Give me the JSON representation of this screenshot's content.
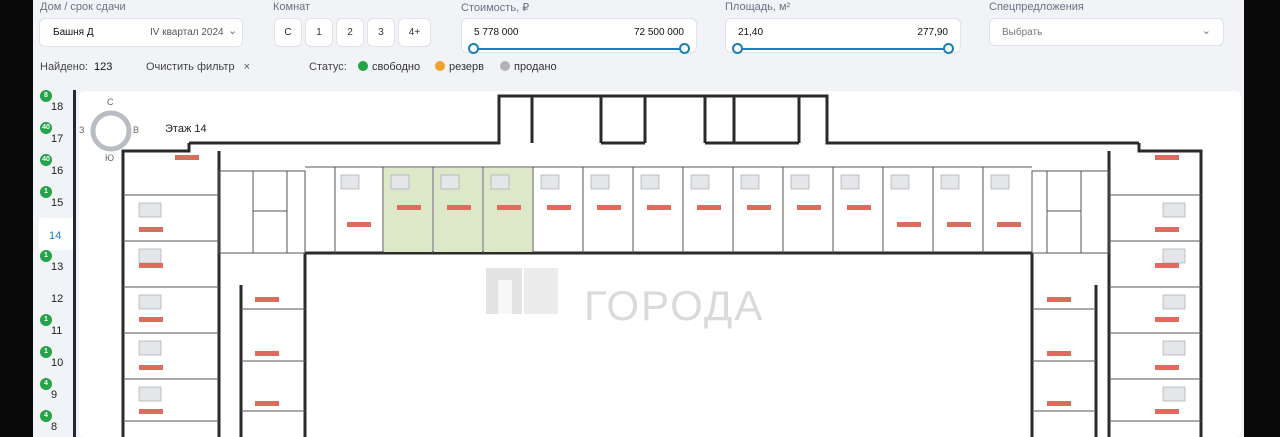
{
  "filters": {
    "house_label": "Дом / срок сдачи",
    "house_value": "Башня Д",
    "house_period": "IV квартал 2024",
    "rooms_label": "Комнат",
    "rooms": [
      "С",
      "1",
      "2",
      "3",
      "4+"
    ],
    "price_label": "Стоимость, ₽",
    "price_min": "5 778 000",
    "price_max": "72 500 000",
    "area_label": "Площадь, м²",
    "area_min": "21,40",
    "area_max": "277,90",
    "special_label": "Спецпредложения",
    "special_placeholder": "Выбрать"
  },
  "summary": {
    "found_label": "Найдено:",
    "found_count": "123",
    "clear_label": "Очистить фильтр",
    "clear_icon": "×",
    "status_label": "Статус:"
  },
  "statuses": [
    {
      "label": "свободно",
      "color": "#22a447"
    },
    {
      "label": "резерв",
      "color": "#f0a22e"
    },
    {
      "label": "продано",
      "color": "#b3b3b3"
    }
  ],
  "floors": [
    {
      "number": "18",
      "badge": "8"
    },
    {
      "number": "17",
      "badge": "40"
    },
    {
      "number": "16",
      "badge": "40"
    },
    {
      "number": "15",
      "badge": "1"
    },
    {
      "number": "14",
      "badge": "",
      "active": true
    },
    {
      "number": "13",
      "badge": "1"
    },
    {
      "number": "12",
      "badge": ""
    },
    {
      "number": "11",
      "badge": "1"
    },
    {
      "number": "10",
      "badge": "1"
    },
    {
      "number": "9",
      "badge": "4"
    },
    {
      "number": "8",
      "badge": "4"
    }
  ],
  "plan": {
    "floor_title": "Этаж 14",
    "compass": {
      "north": "С",
      "west": "З",
      "east": "В",
      "south": "Ю"
    },
    "watermark": "ГОРОДА"
  },
  "colors": {
    "accent": "#1b7fb9",
    "available": "#22a447",
    "selected_unit": "#dce8c8",
    "price_tag": "#e06a5e"
  }
}
